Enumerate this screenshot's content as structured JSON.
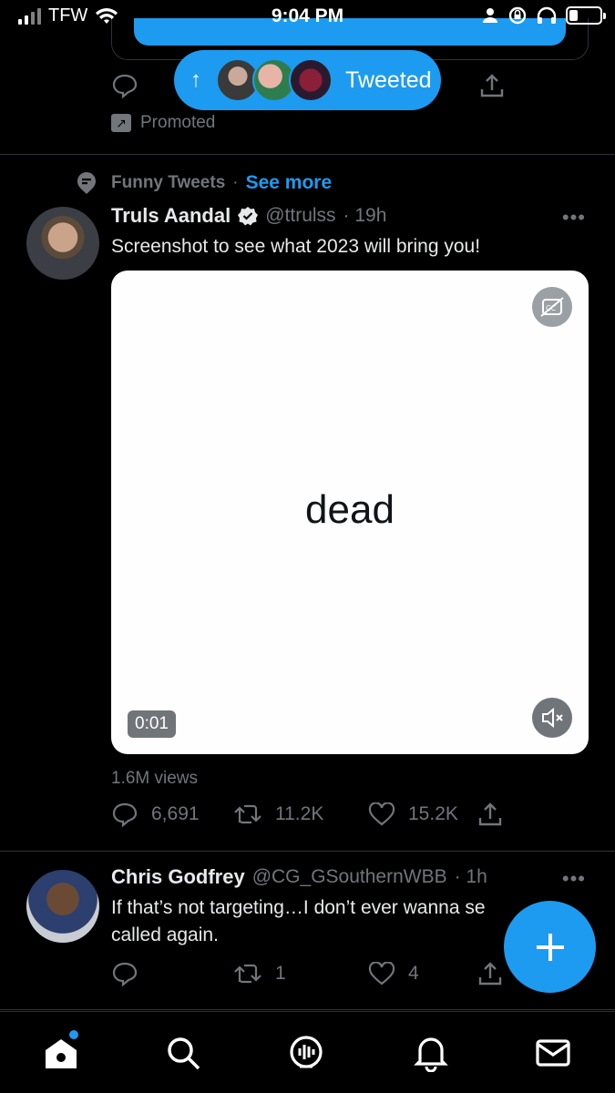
{
  "status_bar": {
    "carrier": "TFW",
    "time": "9:04 PM"
  },
  "top_pill": {
    "label": "Tweeted"
  },
  "promoted": {
    "label": "Promoted"
  },
  "tweet1": {
    "topic": "Funny Tweets",
    "separator": "·",
    "see_more": "See more",
    "name": "Truls Aandal",
    "handle": "@ttrulss",
    "time": "· 19h",
    "text": "Screenshot to see what 2023 will bring you!",
    "media_word": "dead",
    "duration": "0:01",
    "views": "1.6M views",
    "replies": "6,691",
    "retweets": "11.2K",
    "likes": "15.2K"
  },
  "tweet2": {
    "name": "Chris Godfrey",
    "handle": "@CG_GSouthernWBB",
    "time": "· 1h",
    "text_line1": "If that’s not targeting…I don’t ever wanna se",
    "text_line2": "called again.",
    "retweets": "1",
    "likes": "4"
  },
  "nav": {
    "items": [
      "home-icon",
      "search-icon",
      "spaces-icon",
      "notifications-icon",
      "messages-icon"
    ]
  },
  "colors": {
    "accent": "#1d9bf0",
    "background": "#000000",
    "muted": "#71767b"
  }
}
